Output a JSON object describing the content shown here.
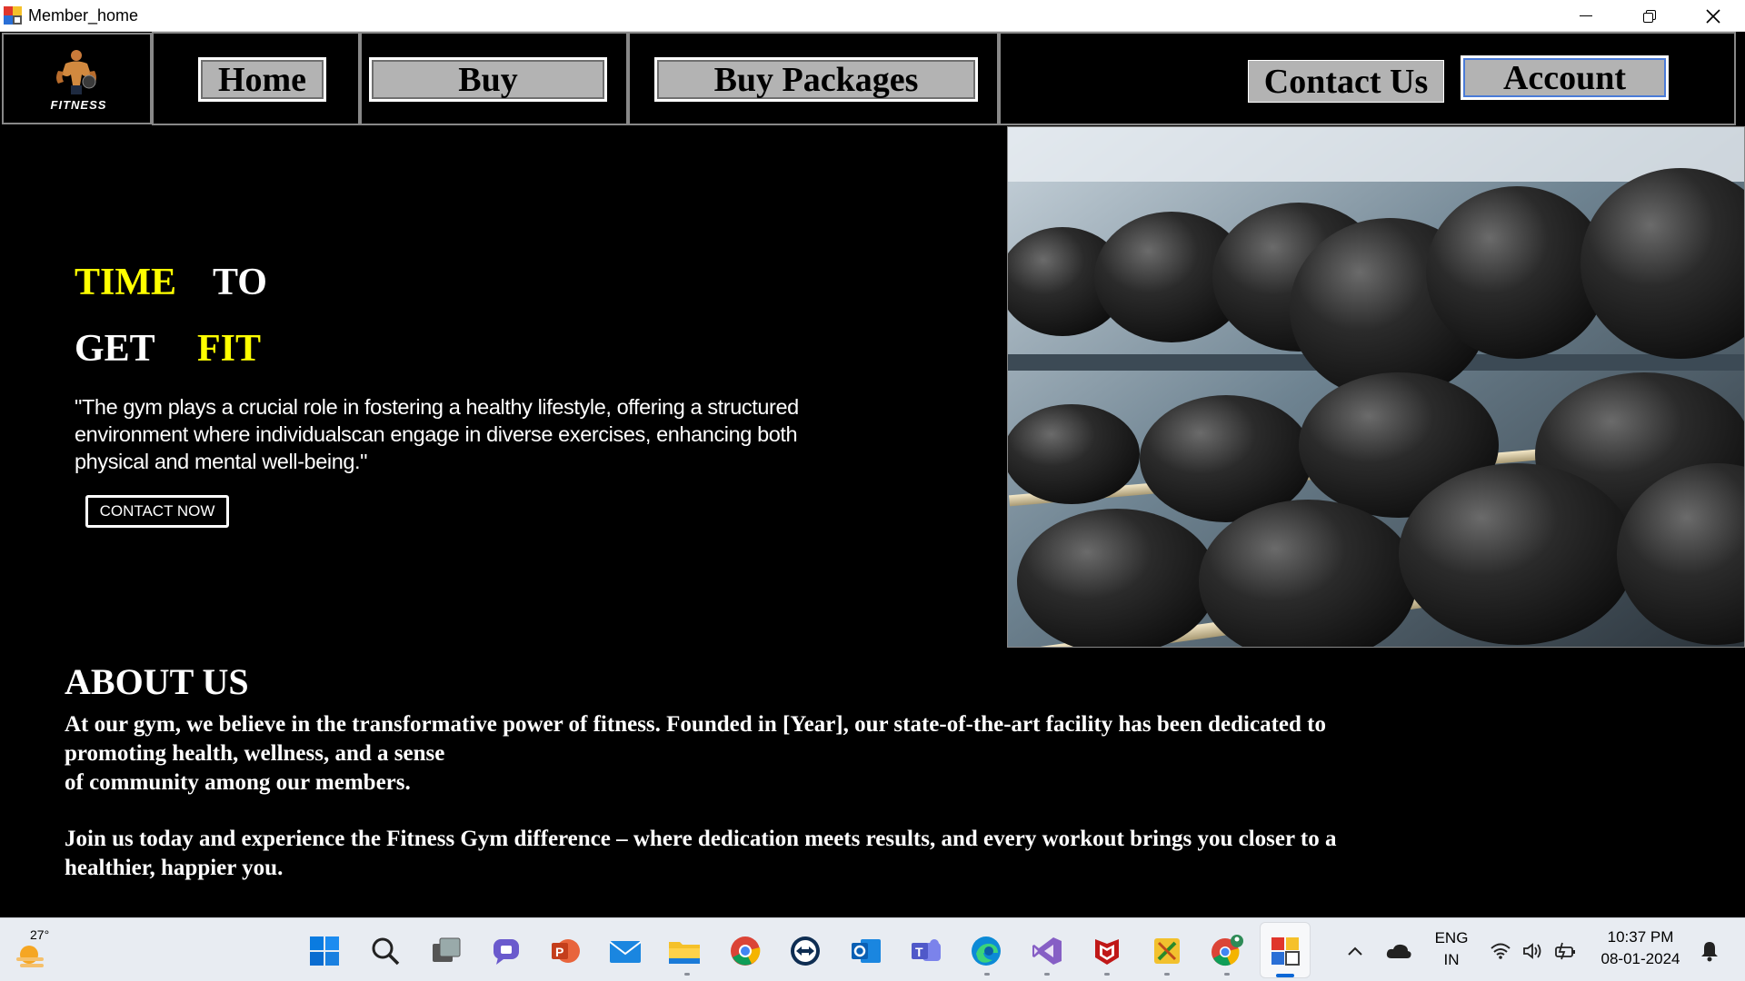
{
  "window": {
    "title": "Member_home"
  },
  "nav": {
    "logo_text": "FITNESS",
    "home": "Home",
    "buy": "Buy",
    "buy_packages": "Buy Packages",
    "contact_us": "Contact Us",
    "account": "Account"
  },
  "hero": {
    "word_time": "TIME",
    "word_to": "TO",
    "word_get": "GET",
    "word_fit": "FIT",
    "quote": "\"The gym plays a crucial role in fostering a healthy lifestyle, offering a structured\n environment where individualscan engage in diverse exercises, enhancing both\n physical and mental well-being.\"",
    "button": "CONTACT NOW"
  },
  "about": {
    "title": "ABOUT US",
    "para1": "At our gym, we believe in the transformative power of fitness. Founded in [Year], our state-of-the-art facility has been dedicated to\npromoting health, wellness, and a sense\nof community among our members.",
    "para2": "Join us today and experience the Fitness Gym difference – where dedication meets results, and every workout brings you closer to a\nhealthier, happier you."
  },
  "taskbar": {
    "temperature": "27°",
    "language": "ENG",
    "region": "IN",
    "time": "10:37 PM",
    "date": "08-01-2024",
    "icons": [
      "start-icon",
      "search-icon",
      "task-view-icon",
      "chat-icon",
      "powerpoint-icon",
      "mail-icon",
      "file-explorer-icon",
      "chrome-icon",
      "teamviewer-icon",
      "outlook-icon",
      "teams-icon",
      "edge-icon",
      "visual-studio-icon",
      "mcafee-icon",
      "tools-app-icon",
      "chrome-profile-icon",
      "winforms-app-icon"
    ],
    "accent": "#0a67d6"
  },
  "colors": {
    "highlight": "#ffff00",
    "background": "#000000",
    "button_gray": "#b3b3b3"
  }
}
